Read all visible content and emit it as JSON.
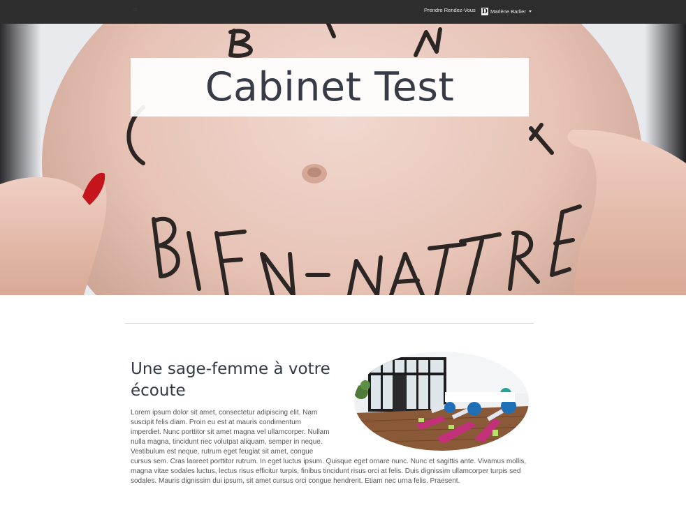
{
  "navbar": {
    "brand_icon": "collapse-icon",
    "appointment_link": "Prendre Rendez-Vous",
    "user": {
      "logo_letter": "D",
      "name": "Marlène Barlier",
      "caret_icon": "caret-down-icon"
    }
  },
  "hero": {
    "title": "Cabinet Test",
    "image_icon": "pregnant-belly-photo"
  },
  "section": {
    "title": "Une sage-femme à votre écoute",
    "image_icon": "yoga-room-photo",
    "body": "Lorem ipsum dolor sit amet, consectetur adipiscing elit. Nam suscipit felis diam. Proin eu est at mauris condimentum imperdiet. Nunc porttitor sit amet magna vel ullamcorper. Nullam nulla magna, tincidunt nec volutpat aliquam, semper in neque. Vestibulum est neque, rutrum eget feugiat sit amet, congue cursus sem. Cras laoreet porttitor rutrum. In eget luctus ipsum. Quisque eget ornare nunc. Nunc et sagittis ante. Vivamus mollis, magna vitae sodales luctus, lectus risus efficitur turpis, finibus tincidunt risus orci at felis. Duis dignissim ullamcorper turpis sed sodales. Mauris dignissim dui ipsum, sit amet cursus orci congue hendrerit. Etiam nec urna felis. Praesent."
  },
  "colors": {
    "navbar_bg": "#2d2d2d",
    "title_text": "#363b45",
    "body_text": "#555555"
  }
}
